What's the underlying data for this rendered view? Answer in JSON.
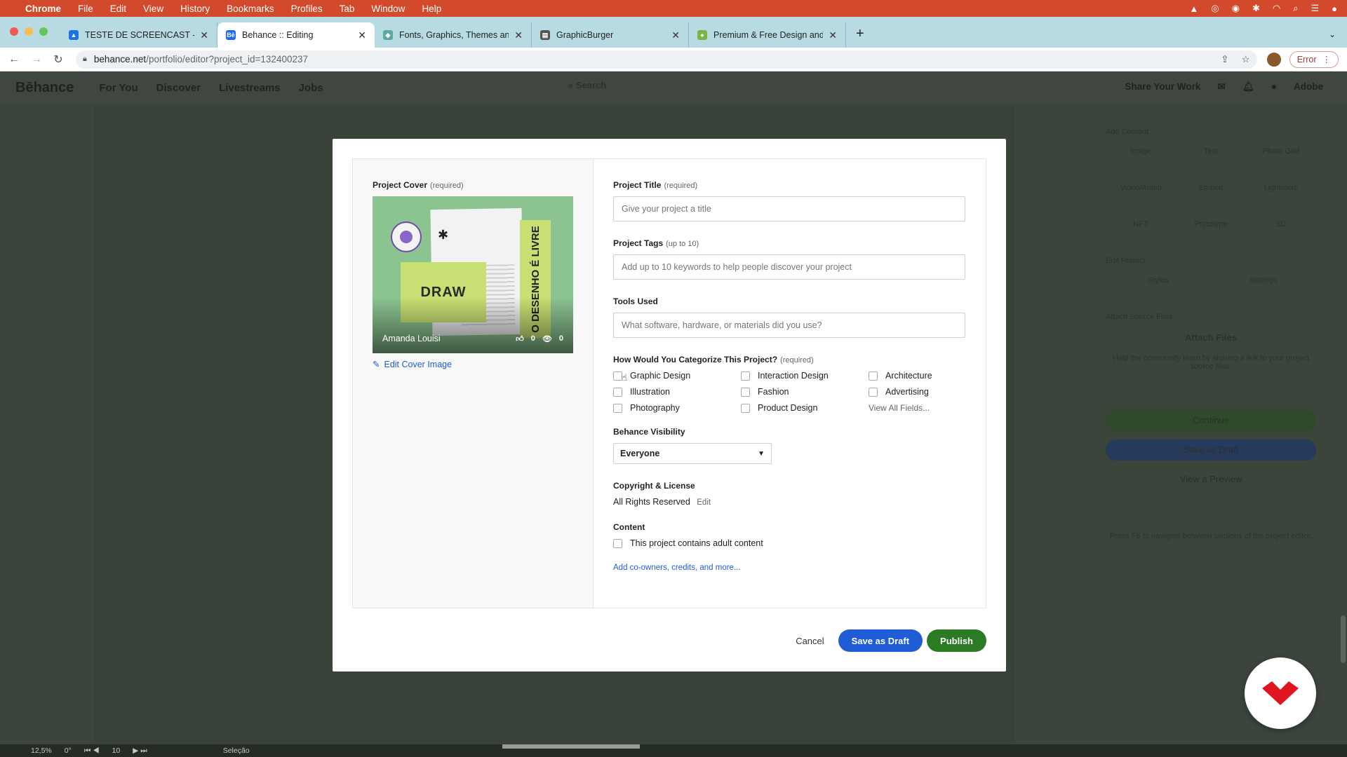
{
  "menubar": {
    "items": [
      "Chrome",
      "File",
      "Edit",
      "View",
      "History",
      "Bookmarks",
      "Profiles",
      "Tab",
      "Window",
      "Help"
    ]
  },
  "tabs": [
    {
      "title": "TESTE DE SCREENCAST - Goo",
      "color": "#1a73e8",
      "glyph": "▲"
    },
    {
      "title": "Behance :: Editing",
      "color": "#1769ff",
      "glyph": "Bē"
    },
    {
      "title": "Fonts, Graphics, Themes and M",
      "color": "#5aa9a0",
      "glyph": "◆"
    },
    {
      "title": "GraphicBurger",
      "color": "#555555",
      "glyph": "▤"
    },
    {
      "title": "Premium & Free Design and W",
      "color": "#7cb342",
      "glyph": "●"
    }
  ],
  "address": {
    "host": "behance.net",
    "path": "/portfolio/editor?project_id=132400237",
    "error_label": "Error"
  },
  "behance": {
    "logo": "Bēhance",
    "nav": [
      "For You",
      "Discover",
      "Livestreams",
      "Jobs"
    ],
    "search_placeholder": "Search",
    "share": "Share Your Work",
    "adobe": "Adobe",
    "side": {
      "add_content": "Add Content",
      "items": [
        "Image",
        "Text",
        "Photo Grid",
        "Video/Audio",
        "Embed",
        "Lightroom",
        "NFT",
        "Prototype",
        "3D"
      ],
      "edit_project": "Edit Project",
      "edit_items": [
        "Styles",
        "Settings"
      ],
      "attach_title": "Attach Source Files",
      "attach_files": "Attach Files",
      "attach_help": "Help the community learn by sharing a link to your project source files.",
      "continue": "Continue",
      "save_draft": "Save as Draft",
      "preview": "View a Preview",
      "hint": "Press F6 to navigate between sections of the project editor."
    }
  },
  "modal": {
    "cover_label": "Project Cover",
    "cover_req": "(required)",
    "cover_owner": "Amanda Louisi",
    "cover_likes": "0",
    "cover_views": "0",
    "cover_draw": "DRAW",
    "cover_spine": "O DESENHO É LIVRE",
    "edit_cover": "Edit Cover Image",
    "title_label": "Project Title",
    "title_req": "(required)",
    "title_placeholder": "Give your project a title",
    "tags_label": "Project Tags",
    "tags_req": "(up to 10)",
    "tags_placeholder": "Add up to 10 keywords to help people discover your project",
    "tools_label": "Tools Used",
    "tools_placeholder": "What software, hardware, or materials did you use?",
    "category_label": "How Would You Categorize This Project?",
    "category_req": "(required)",
    "categories": [
      "Graphic Design",
      "Interaction Design",
      "Architecture",
      "Illustration",
      "Fashion",
      "Advertising",
      "Photography",
      "Product Design"
    ],
    "view_all": "View All Fields...",
    "visibility_label": "Behance Visibility",
    "visibility_value": "Everyone",
    "copyright_label": "Copyright & License",
    "copyright_value": "All Rights Reserved",
    "copyright_edit": "Edit",
    "content_label": "Content",
    "adult_label": "This project contains adult content",
    "coowners": "Add co-owners, credits, and more...",
    "cancel": "Cancel",
    "save_draft": "Save as Draft",
    "publish": "Publish"
  },
  "statusbar": {
    "zoom": "12,5%",
    "angle": "0°",
    "page": "10",
    "mode": "Seleção"
  },
  "colors": {
    "menubar": "#d3492b",
    "tabstrip": "#b8dbe3",
    "primary": "#1f5cd6",
    "publish": "#2b7a24",
    "reclogo": "#e0151f"
  }
}
